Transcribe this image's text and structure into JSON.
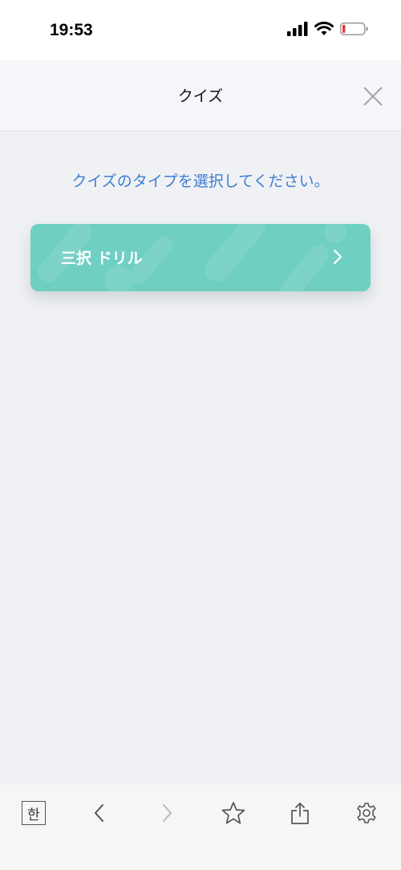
{
  "status": {
    "time": "19:53"
  },
  "header": {
    "title": "クイズ"
  },
  "main": {
    "prompt": "クイズのタイプを選択してください。",
    "quiz_types": [
      {
        "label": "三択 ドリル"
      }
    ]
  },
  "toolbar": {
    "hangul_label": "한"
  },
  "colors": {
    "accent": "#3d7fd1",
    "card": "#6fcfc3",
    "battery_low": "#e23b3b"
  },
  "icons": [
    "signal-icon",
    "wifi-icon",
    "battery-icon",
    "close-icon",
    "chevron-right-icon",
    "back-icon",
    "forward-icon",
    "star-icon",
    "share-icon",
    "gear-icon"
  ]
}
